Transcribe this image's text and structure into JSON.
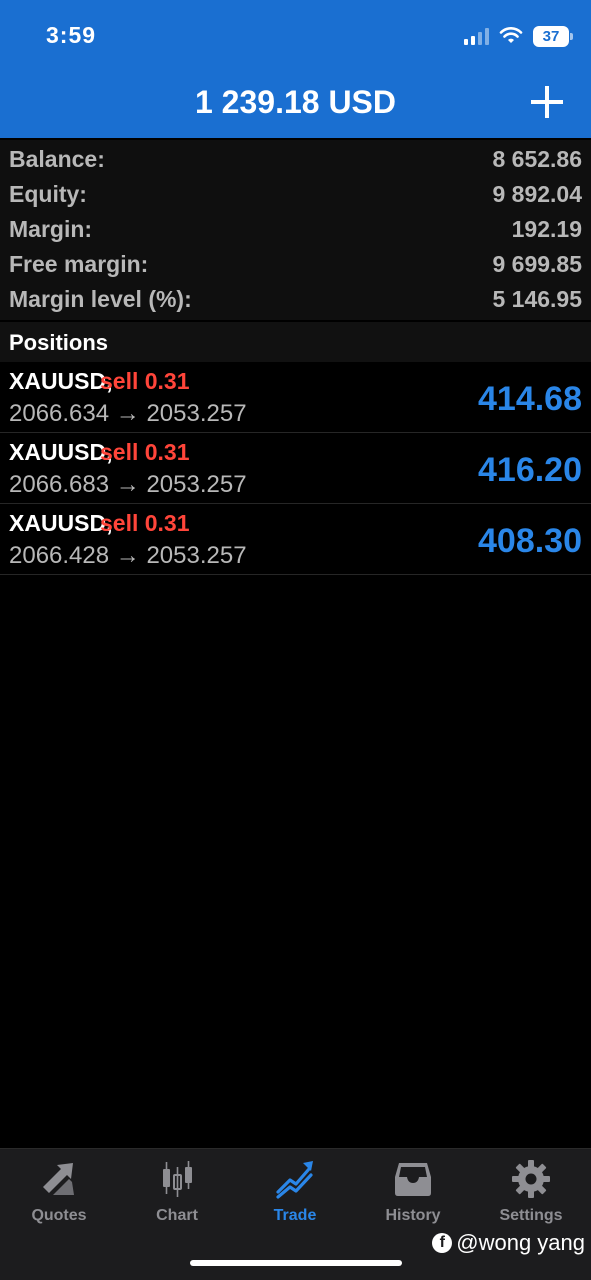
{
  "status_bar": {
    "time": "3:59",
    "battery": "37"
  },
  "header": {
    "title": "1 239.18 USD"
  },
  "summary": [
    {
      "label": "Balance:",
      "value": "8 652.86"
    },
    {
      "label": "Equity:",
      "value": "9 892.04"
    },
    {
      "label": "Margin:",
      "value": "192.19"
    },
    {
      "label": "Free margin:",
      "value": "9 699.85"
    },
    {
      "label": "Margin level (%):",
      "value": "5 146.95"
    }
  ],
  "positions_title": "Positions",
  "positions": [
    {
      "symbol": "XAUUSD,",
      "side": "sell 0.31",
      "prices": "2066.634 → 2053.257",
      "profit": "414.68"
    },
    {
      "symbol": "XAUUSD,",
      "side": "sell 0.31",
      "prices": "2066.683 → 2053.257",
      "profit": "416.20"
    },
    {
      "symbol": "XAUUSD,",
      "side": "sell 0.31",
      "prices": "2066.428 → 2053.257",
      "profit": "408.30"
    }
  ],
  "tabs": [
    {
      "label": "Quotes",
      "icon": "quotes-arrows-icon"
    },
    {
      "label": "Chart",
      "icon": "candlestick-icon"
    },
    {
      "label": "Trade",
      "icon": "trade-trend-icon",
      "active": true
    },
    {
      "label": "History",
      "icon": "inbox-icon"
    },
    {
      "label": "Settings",
      "icon": "gear-icon"
    }
  ],
  "watermark": "@wong yang",
  "colors": {
    "header": "#1a6fd1",
    "profit": "#2a86e8",
    "sell": "#ff453a",
    "tab_active": "#2a86e8",
    "tab_inactive": "#8e8e93"
  }
}
